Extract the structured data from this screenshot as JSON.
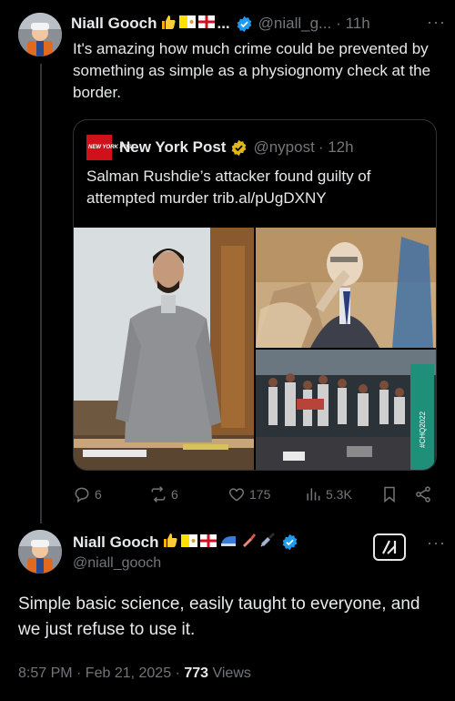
{
  "tweet1": {
    "name": "Niall Gooch",
    "emojis": [
      "thumbs-up",
      "vatican-flag",
      "england-flag"
    ],
    "ellipsis": "...",
    "handle": "@niall_g...",
    "time": "· 11h",
    "more": "···",
    "text": "It's amazing how much crime could be prevented by something as simple as a physiognomy check at the border."
  },
  "quote": {
    "logo_text": "NEW YORK POST",
    "name": "New York Post",
    "handle": "@nypost",
    "time": "· 12h",
    "text": "Salman Rushdie’s attacker found guilty of attempted murder trib.al/pUgDXNY",
    "images": [
      "courtroom-defendant-photo",
      "courtroom-sketch",
      "stage-attack-scene-photo"
    ]
  },
  "actions": {
    "replies": "6",
    "reposts": "6",
    "likes": "175",
    "views": "5.3K"
  },
  "tweet2": {
    "name": "Niall Gooch",
    "emojis": [
      "thumbs-up",
      "vatican-flag",
      "england-flag",
      "iron",
      "lipstick",
      "syringe"
    ],
    "handle": "@niall_gooch",
    "more": "···",
    "text": "Simple basic science, easily taught to everyone, and we just refuse to use it.",
    "time": "8:57 PM · Feb 21, 2025 · ",
    "view_count": "773",
    "views_label": " Views"
  },
  "colors": {
    "background": "#000000",
    "text_primary": "#e7e9ea",
    "text_secondary": "#71767b",
    "border": "#2f3336",
    "verified_blue": "#1d9bf0",
    "verified_gold": "#e2b719",
    "nypost_red": "#d0111b"
  }
}
